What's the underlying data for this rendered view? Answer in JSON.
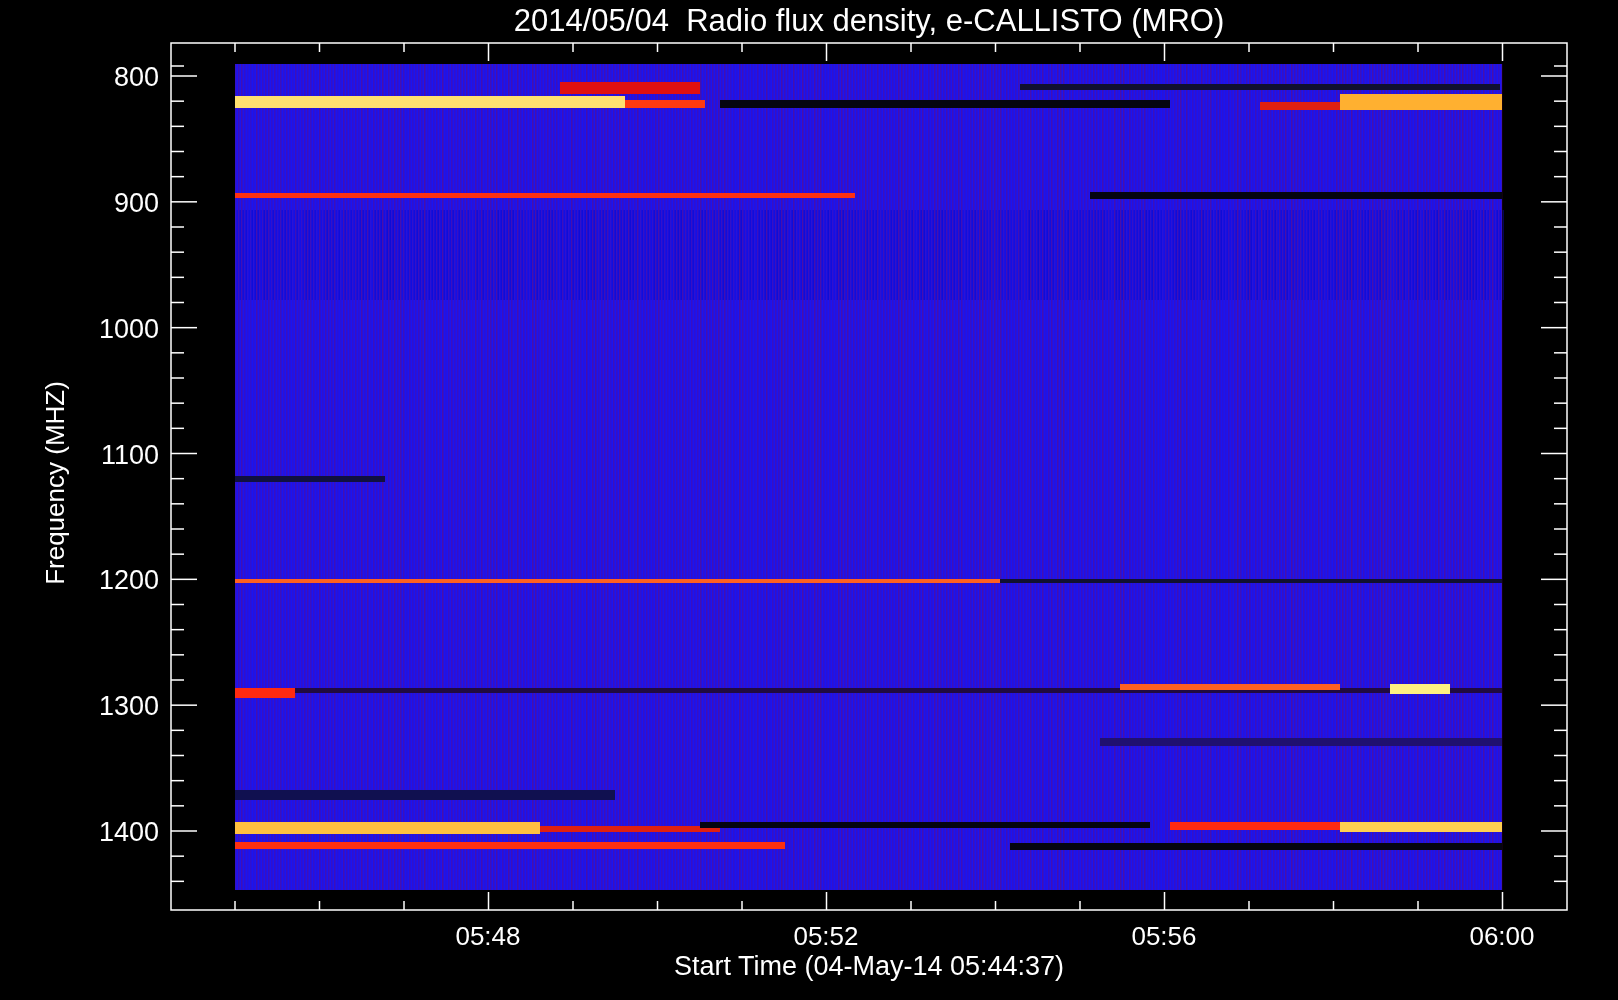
{
  "title": "2014/05/04  Radio flux density, e-CALLISTO (MRO)",
  "y_axis": {
    "label": "Frequency (MHZ)",
    "tick_labels": [
      "800",
      "900",
      "1000",
      "1100",
      "1200",
      "1300",
      "1400"
    ]
  },
  "x_axis": {
    "label": "Start Time (04-May-14 05:44:37)",
    "tick_labels": [
      "05:48",
      "05:52",
      "05:56",
      "06:00"
    ]
  }
}
